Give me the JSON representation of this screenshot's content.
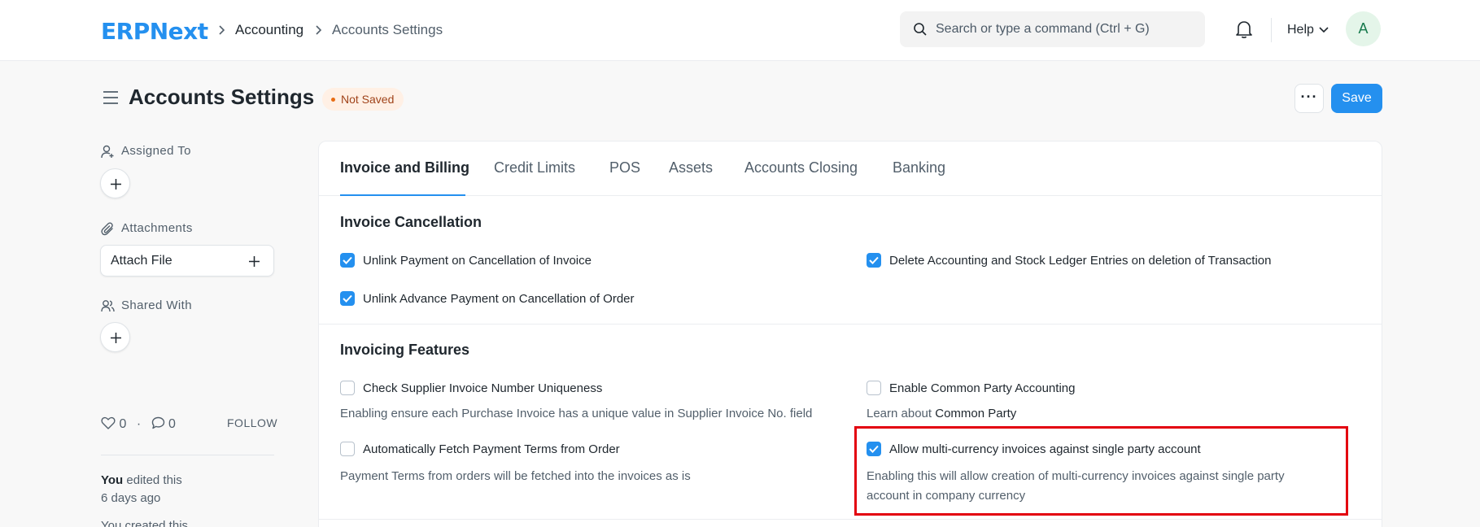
{
  "navbar": {
    "logo": "ERPNext",
    "breadcrumbs": [
      "Accounting",
      "Accounts Settings"
    ],
    "search_placeholder": "Search or type a command (Ctrl + G)",
    "help_label": "Help",
    "avatar_initial": "A"
  },
  "page": {
    "title": "Accounts Settings",
    "status": "Not Saved",
    "more_label": "···",
    "save_label": "Save"
  },
  "sidebar": {
    "assigned_to": "Assigned To",
    "attachments": "Attachments",
    "attach_file": "Attach File",
    "shared_with": "Shared With",
    "likes_count": "0",
    "comments_count": "0",
    "follow": "FOLLOW",
    "activity_user": "You",
    "activity_action": " edited this",
    "activity_time": "6 days ago",
    "activity_next": "You created this"
  },
  "tabs": [
    {
      "label": "Invoice and Billing",
      "active": true
    },
    {
      "label": "Credit Limits",
      "active": false
    },
    {
      "label": "POS",
      "active": false
    },
    {
      "label": "Assets",
      "active": false
    },
    {
      "label": "Accounts Closing",
      "active": false
    },
    {
      "label": "Banking",
      "active": false
    }
  ],
  "sections": {
    "invoice_cancellation": {
      "title": "Invoice Cancellation",
      "fields": [
        {
          "label": "Unlink Payment on Cancellation of Invoice",
          "checked": true
        },
        {
          "label": "Delete Accounting and Stock Ledger Entries on deletion of Transaction",
          "checked": true
        },
        {
          "label": "Unlink Advance Payment on Cancellation of Order",
          "checked": true
        }
      ]
    },
    "invoicing_features": {
      "title": "Invoicing Features",
      "fields": [
        {
          "label": "Check Supplier Invoice Number Uniqueness",
          "checked": false,
          "description": "Enabling ensure each Purchase Invoice has a unique value in Supplier Invoice No. field"
        },
        {
          "label": "Enable Common Party Accounting",
          "checked": false,
          "description_prefix": "Learn about ",
          "description_link": "Common Party"
        },
        {
          "label": "Automatically Fetch Payment Terms from Order",
          "checked": false,
          "description": "Payment Terms from orders will be fetched into the invoices as is"
        },
        {
          "label": "Allow multi-currency invoices against single party account",
          "checked": true,
          "description_line1": "Enabling this will allow creation of multi-currency invoices against single party",
          "description_line2": "account in company currency"
        }
      ]
    }
  },
  "colors": {
    "brand": "#2490ef",
    "highlight": "#e3000f"
  }
}
